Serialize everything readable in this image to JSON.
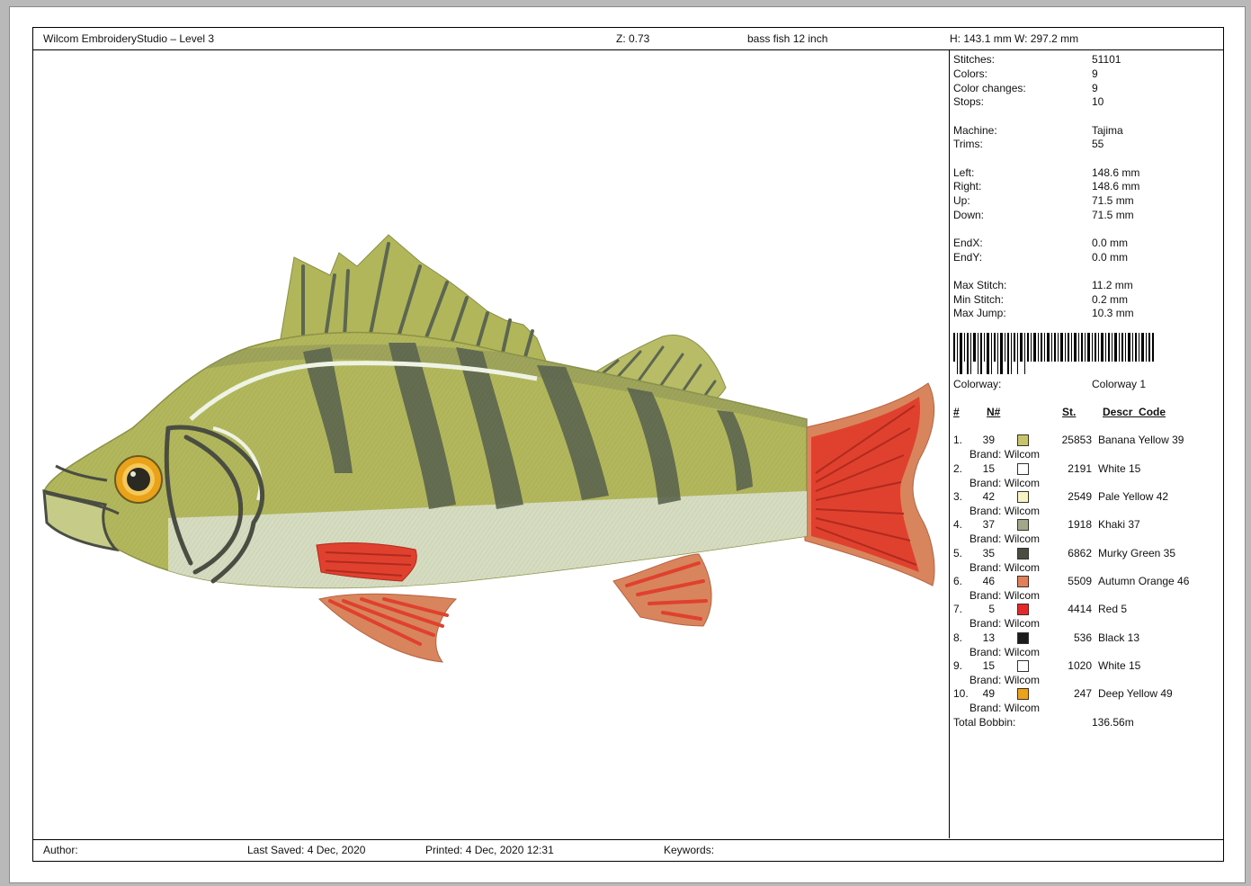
{
  "header": {
    "app_title": "Wilcom EmbroideryStudio – Level 3",
    "zoom": "Z: 0.73",
    "design_name": "bass fish 12 inch",
    "dimensions": "H: 143.1 mm   W: 297.2 mm"
  },
  "stats": [
    {
      "label": "Stitches:",
      "value": "51101"
    },
    {
      "label": "Colors:",
      "value": "9"
    },
    {
      "label": "Color changes:",
      "value": "9"
    },
    {
      "label": "Stops:",
      "value": "10"
    },
    {
      "label": "Machine:",
      "value": "Tajima"
    },
    {
      "label": "Trims:",
      "value": "55"
    },
    {
      "label": "Left:",
      "value": "148.6 mm"
    },
    {
      "label": "Right:",
      "value": "148.6 mm"
    },
    {
      "label": "Up:",
      "value": "71.5 mm"
    },
    {
      "label": "Down:",
      "value": "71.5 mm"
    },
    {
      "label": "EndX:",
      "value": "0.0 mm"
    },
    {
      "label": "EndY:",
      "value": "0.0 mm"
    },
    {
      "label": "Max Stitch:",
      "value": "11.2 mm"
    },
    {
      "label": "Min Stitch:",
      "value": "0.2 mm"
    },
    {
      "label": "Max Jump:",
      "value": "10.3 mm"
    }
  ],
  "colorway": {
    "label": "Colorway:",
    "value": "Colorway 1"
  },
  "color_table": {
    "headers": {
      "index": "#",
      "number": "N#",
      "stitches": "St.",
      "description": "Descr_Code"
    },
    "rows": [
      {
        "index": "1.",
        "number": "39",
        "color": "#c8c46e",
        "stitches": "25853",
        "description": "Banana Yellow 39",
        "brand": "Brand: Wilcom"
      },
      {
        "index": "2.",
        "number": "15",
        "color": "#ffffff",
        "stitches": "2191",
        "description": "White 15",
        "brand": "Brand: Wilcom"
      },
      {
        "index": "3.",
        "number": "42",
        "color": "#f8f3c6",
        "stitches": "2549",
        "description": "Pale Yellow 42",
        "brand": "Brand: Wilcom"
      },
      {
        "index": "4.",
        "number": "37",
        "color": "#a4a68a",
        "stitches": "1918",
        "description": "Khaki 37",
        "brand": "Brand: Wilcom"
      },
      {
        "index": "5.",
        "number": "35",
        "color": "#4a4d42",
        "stitches": "6862",
        "description": "Murky Green 35",
        "brand": "Brand: Wilcom"
      },
      {
        "index": "6.",
        "number": "46",
        "color": "#e0805a",
        "stitches": "5509",
        "description": "Autumn Orange 46",
        "brand": "Brand: Wilcom"
      },
      {
        "index": "7.",
        "number": "5",
        "color": "#e32a2a",
        "stitches": "4414",
        "description": "Red 5",
        "brand": "Brand: Wilcom"
      },
      {
        "index": "8.",
        "number": "13",
        "color": "#1c1c1c",
        "stitches": "536",
        "description": "Black 13",
        "brand": "Brand: Wilcom"
      },
      {
        "index": "9.",
        "number": "15",
        "color": "#ffffff",
        "stitches": "1020",
        "description": "White 15",
        "brand": "Brand: Wilcom"
      },
      {
        "index": "10.",
        "number": "49",
        "color": "#eca21a",
        "stitches": "247",
        "description": "Deep Yellow 49",
        "brand": "Brand: Wilcom"
      }
    ]
  },
  "total_bobbin": {
    "label": "Total Bobbin:",
    "value": "136.56m"
  },
  "footer": {
    "author": "Author:",
    "last_saved": "Last Saved:  4 Dec, 2020",
    "printed": "Printed:  4 Dec, 2020 12:31",
    "keywords": "Keywords:"
  },
  "colors": {
    "fish_body": "#b3b75c",
    "fish_belly": "#d6dcc0",
    "fish_bars": "#5d6650",
    "fin_red": "#e0402e",
    "fin_orange": "#d8845c",
    "eye_ring": "#e9a21a"
  }
}
